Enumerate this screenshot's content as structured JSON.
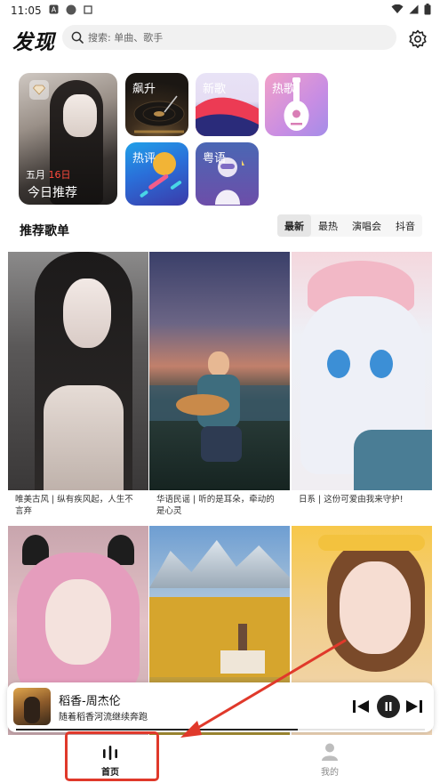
{
  "status_bar": {
    "time": "11:05"
  },
  "header": {
    "title": "发现",
    "search_placeholder": "搜索: 单曲、歌手"
  },
  "featured": {
    "daily": {
      "month": "五月",
      "day": "16日",
      "title": "今日推荐"
    },
    "tiles": [
      {
        "label": "飙升"
      },
      {
        "label": "新歌"
      },
      {
        "label": "热歌"
      },
      {
        "label": "热评"
      },
      {
        "label": "粤语"
      }
    ]
  },
  "playlists": {
    "title": "推荐歌单",
    "tabs": [
      {
        "label": "最新",
        "active": true
      },
      {
        "label": "最热",
        "active": false
      },
      {
        "label": "演唱会",
        "active": false
      },
      {
        "label": "抖音",
        "active": false
      }
    ],
    "items": [
      {
        "caption": "唯美古风 | 纵有疾风起，人生不言弃"
      },
      {
        "caption": "华语民谣 | 听的是耳朵，牵动的是心灵"
      },
      {
        "caption": "日系 | 这份可爱由我来守护!"
      },
      {
        "caption": ""
      },
      {
        "caption": ""
      },
      {
        "caption": ""
      }
    ]
  },
  "player": {
    "song": "稻香-周杰伦",
    "lyric": "随着稻香河流继续奔跑",
    "progress": 0.69
  },
  "bottom_nav": {
    "items": [
      {
        "label": "首页",
        "active": true
      },
      {
        "label": "我的",
        "active": false
      }
    ]
  },
  "colors": {
    "accent_highlight": "#e0392b",
    "date_red": "#ff4a3d"
  }
}
